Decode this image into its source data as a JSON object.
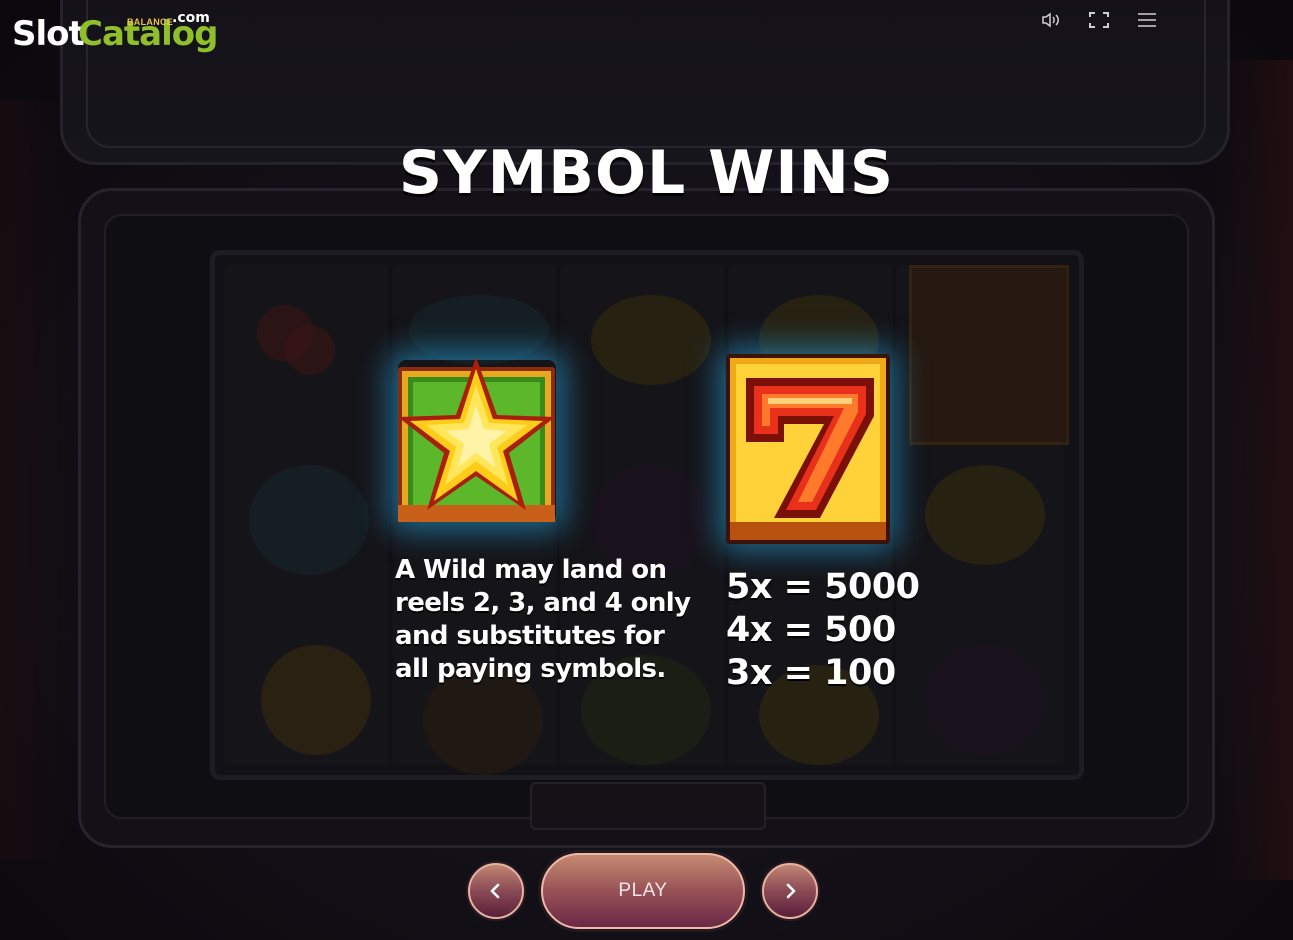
{
  "header": {
    "logo_slot": "Slot",
    "logo_catalog": "Catalog",
    "logo_com": ".com",
    "balance_label": "BALANCE",
    "icons": [
      "volume-icon",
      "fullscreen-icon",
      "menu-icon"
    ]
  },
  "page": {
    "title": "SYMBOL WINS"
  },
  "wild": {
    "icon": "star-wild-icon",
    "lines": [
      "A Wild may land on",
      "reels 2, 3, and 4 only",
      "and substitutes for",
      "all paying symbols."
    ]
  },
  "seven": {
    "icon": "seven-icon",
    "payouts": [
      "5x = 5000",
      "4x = 500",
      "3x = 100"
    ]
  },
  "nav": {
    "prev_icon": "chevron-left-icon",
    "play_label": "PLAY",
    "next_icon": "chevron-right-icon"
  },
  "colors": {
    "logo_green": "#8fbf2a",
    "glow_blue": "#28aae6",
    "button_rose": "#9a5458"
  }
}
